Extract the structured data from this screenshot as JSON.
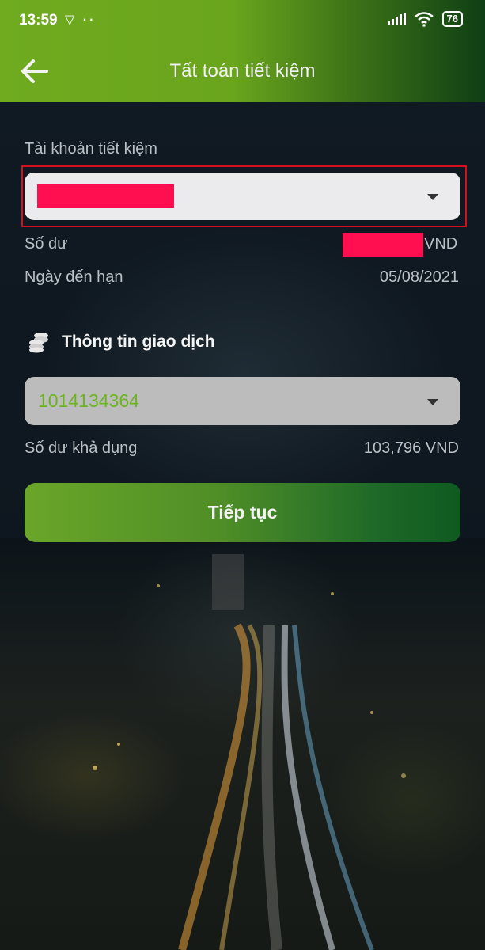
{
  "status_bar": {
    "time": "13:59",
    "notification_icons": "▽ ··",
    "battery": "76"
  },
  "header": {
    "title": "Tất toán tiết kiệm",
    "back_icon": "arrow-left-icon"
  },
  "savings": {
    "label": "Tài khoản tiết kiệm",
    "balance_label": "Số dư",
    "balance_currency": "VND",
    "due_date_label": "Ngày đến hạn",
    "due_date": "05/08/2021"
  },
  "transaction": {
    "section_title": "Thông tin giao dịch",
    "section_icon": "coins-icon",
    "account_number": "1014134364",
    "available_label": "Số dư khả dụng",
    "available_value": "103,796 VND"
  },
  "actions": {
    "continue_label": "Tiếp tục"
  },
  "colors": {
    "accent_green": "#6bb31f",
    "redaction": "#ff0f4f",
    "highlight": "#d61021"
  }
}
